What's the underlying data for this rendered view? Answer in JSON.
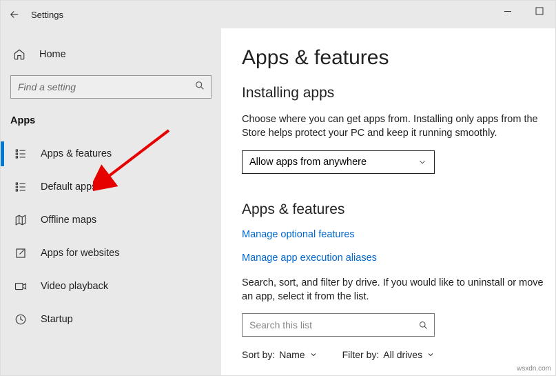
{
  "window": {
    "title": "Settings"
  },
  "sidebar": {
    "home": "Home",
    "search_placeholder": "Find a setting",
    "section": "Apps",
    "items": [
      {
        "label": "Apps & features"
      },
      {
        "label": "Default apps"
      },
      {
        "label": "Offline maps"
      },
      {
        "label": "Apps for websites"
      },
      {
        "label": "Video playback"
      },
      {
        "label": "Startup"
      }
    ]
  },
  "content": {
    "heading": "Apps & features",
    "installing_title": "Installing apps",
    "installing_desc": "Choose where you can get apps from. Installing only apps from the Store helps protect your PC and keep it running smoothly.",
    "dropdown_value": "Allow apps from anywhere",
    "section2_title": "Apps & features",
    "link_optional": "Manage optional features",
    "link_aliases": "Manage app execution aliases",
    "list_desc": "Search, sort, and filter by drive. If you would like to uninstall or move an app, select it from the list.",
    "search_list_placeholder": "Search this list",
    "sort_label": "Sort by:",
    "sort_value": "Name",
    "filter_label": "Filter by:",
    "filter_value": "All drives"
  },
  "watermark": "wsxdn.com"
}
